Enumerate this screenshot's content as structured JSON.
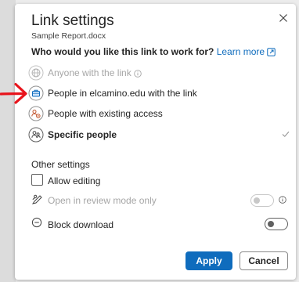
{
  "dialog": {
    "title": "Link settings",
    "filename": "Sample Report.docx",
    "question": "Who would you like this link to work for?",
    "learn_more": "Learn more"
  },
  "options": [
    {
      "label": "Anyone with the link",
      "state": "disabled",
      "icon": "globe-icon"
    },
    {
      "label": "People in elcamino.edu with the link",
      "state": "enabled",
      "icon": "briefcase-icon"
    },
    {
      "label": "People with existing access",
      "state": "enabled",
      "icon": "people-existing-icon"
    },
    {
      "label": "Specific people",
      "state": "selected",
      "icon": "people-icon"
    }
  ],
  "other_settings": {
    "heading": "Other settings",
    "allow_editing": {
      "label": "Allow editing",
      "checked": false
    },
    "review_mode": {
      "label": "Open in review mode only",
      "enabled": false,
      "on": false
    },
    "block_download": {
      "label": "Block download",
      "on": false
    }
  },
  "buttons": {
    "apply": "Apply",
    "cancel": "Cancel"
  },
  "colors": {
    "accent": "#0f6cbd",
    "annotation_arrow": "#e8141c",
    "disabled_text": "#a6a6a6",
    "briefcase_icon": "#0f6cbd",
    "people_existing_icon": "#c0532d"
  }
}
